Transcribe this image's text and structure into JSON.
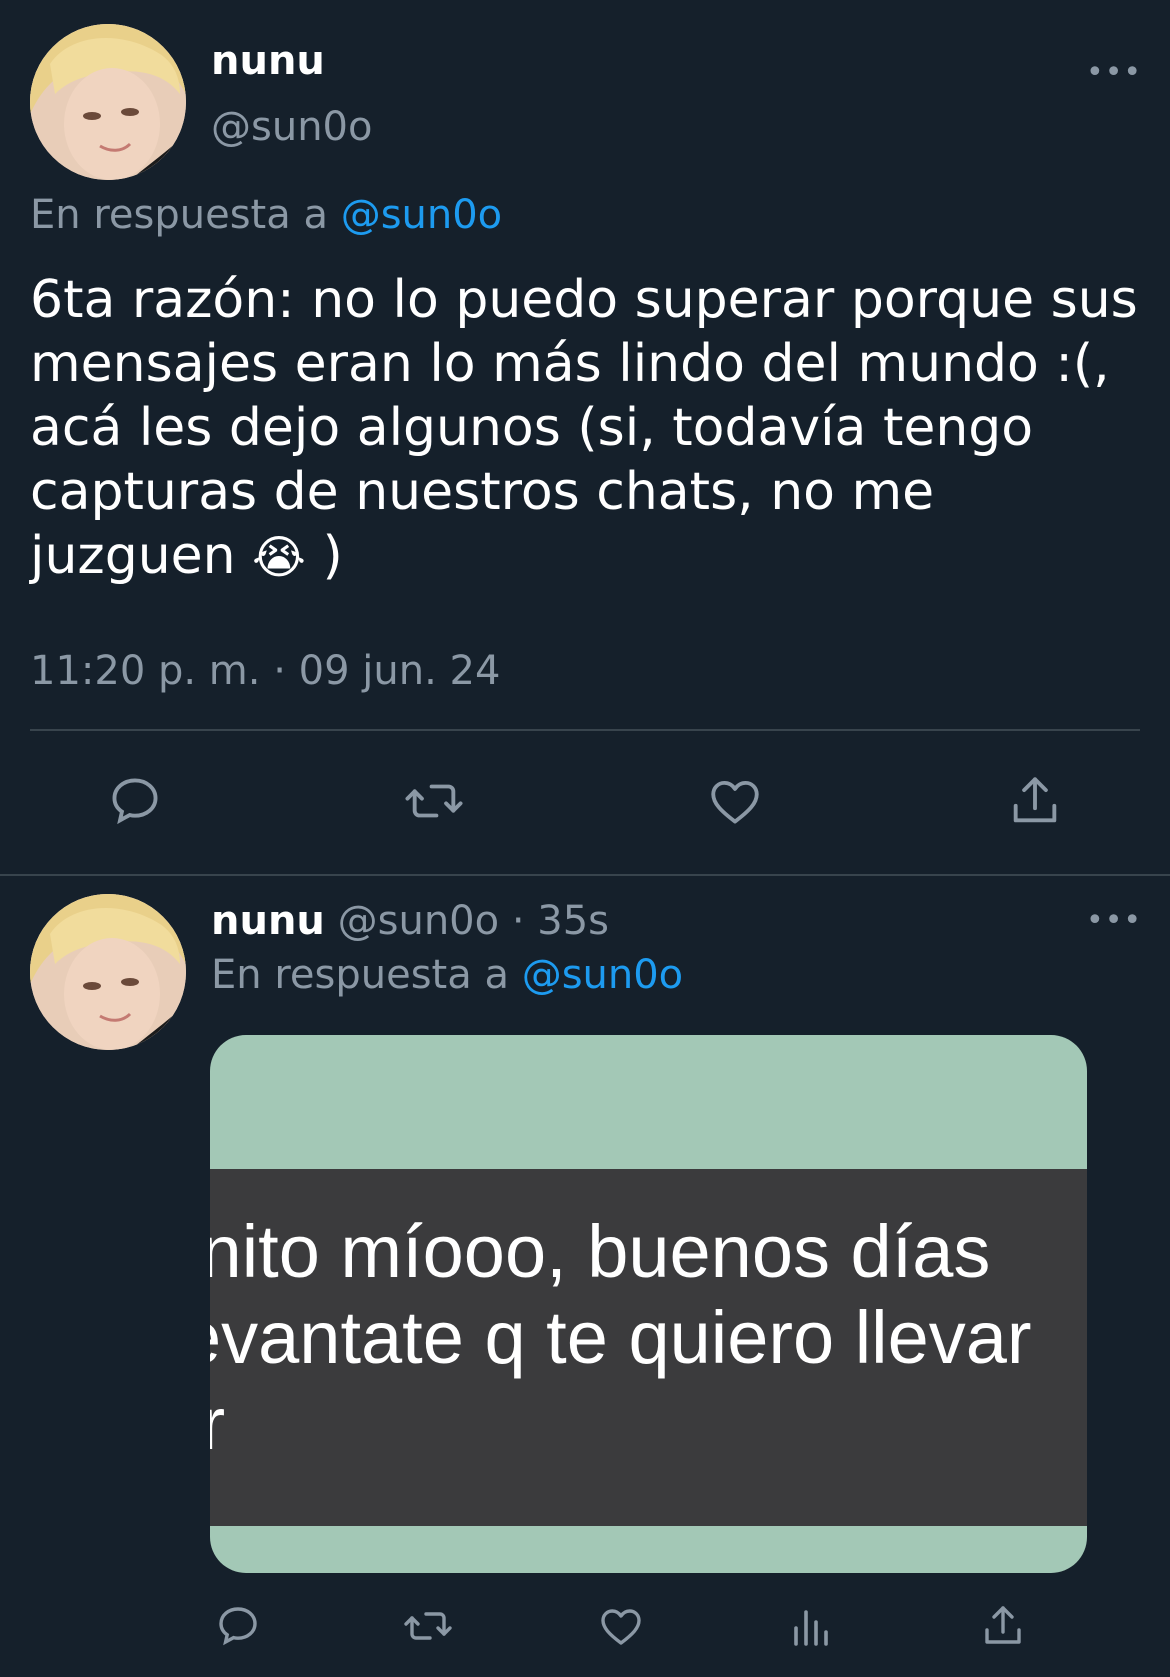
{
  "tweet1": {
    "display_name": "nunu",
    "handle": "@sun0o",
    "reply_prefix": "En respuesta a",
    "reply_handle": "@sun0o",
    "text": "6ta razón: no lo puedo superar porque sus mensajes eran lo más lindo del mundo :(, acá les dejo algunos (si, todavía tengo capturas de nuestros chats, no me juzguen",
    "emoji": "😭",
    "text_end": ")",
    "timestamp": "11:20 p. m. · 09 jun. 24",
    "more_label": "•••"
  },
  "tweet2": {
    "display_name": "nunu",
    "handle": "@sun0o",
    "separator": "·",
    "time": "35s",
    "reply_prefix": "En respuesta a",
    "reply_handle": "@sun0o",
    "more_label": "•••",
    "media": {
      "lines": [
        "ınito míooo, buenos días",
        "evantate q te quiero llevar",
        "ır"
      ]
    }
  },
  "icons": {
    "reply": "reply-icon",
    "retweet": "retweet-icon",
    "like": "heart-icon",
    "analytics": "analytics-icon",
    "share": "share-icon"
  },
  "colors": {
    "background": "#15202b",
    "text": "#ffffff",
    "muted": "#8b98a5",
    "link": "#1d9bf0",
    "divider": "#38444d",
    "media_green": "#a3c8b6",
    "media_band": "#3b3b3d"
  }
}
